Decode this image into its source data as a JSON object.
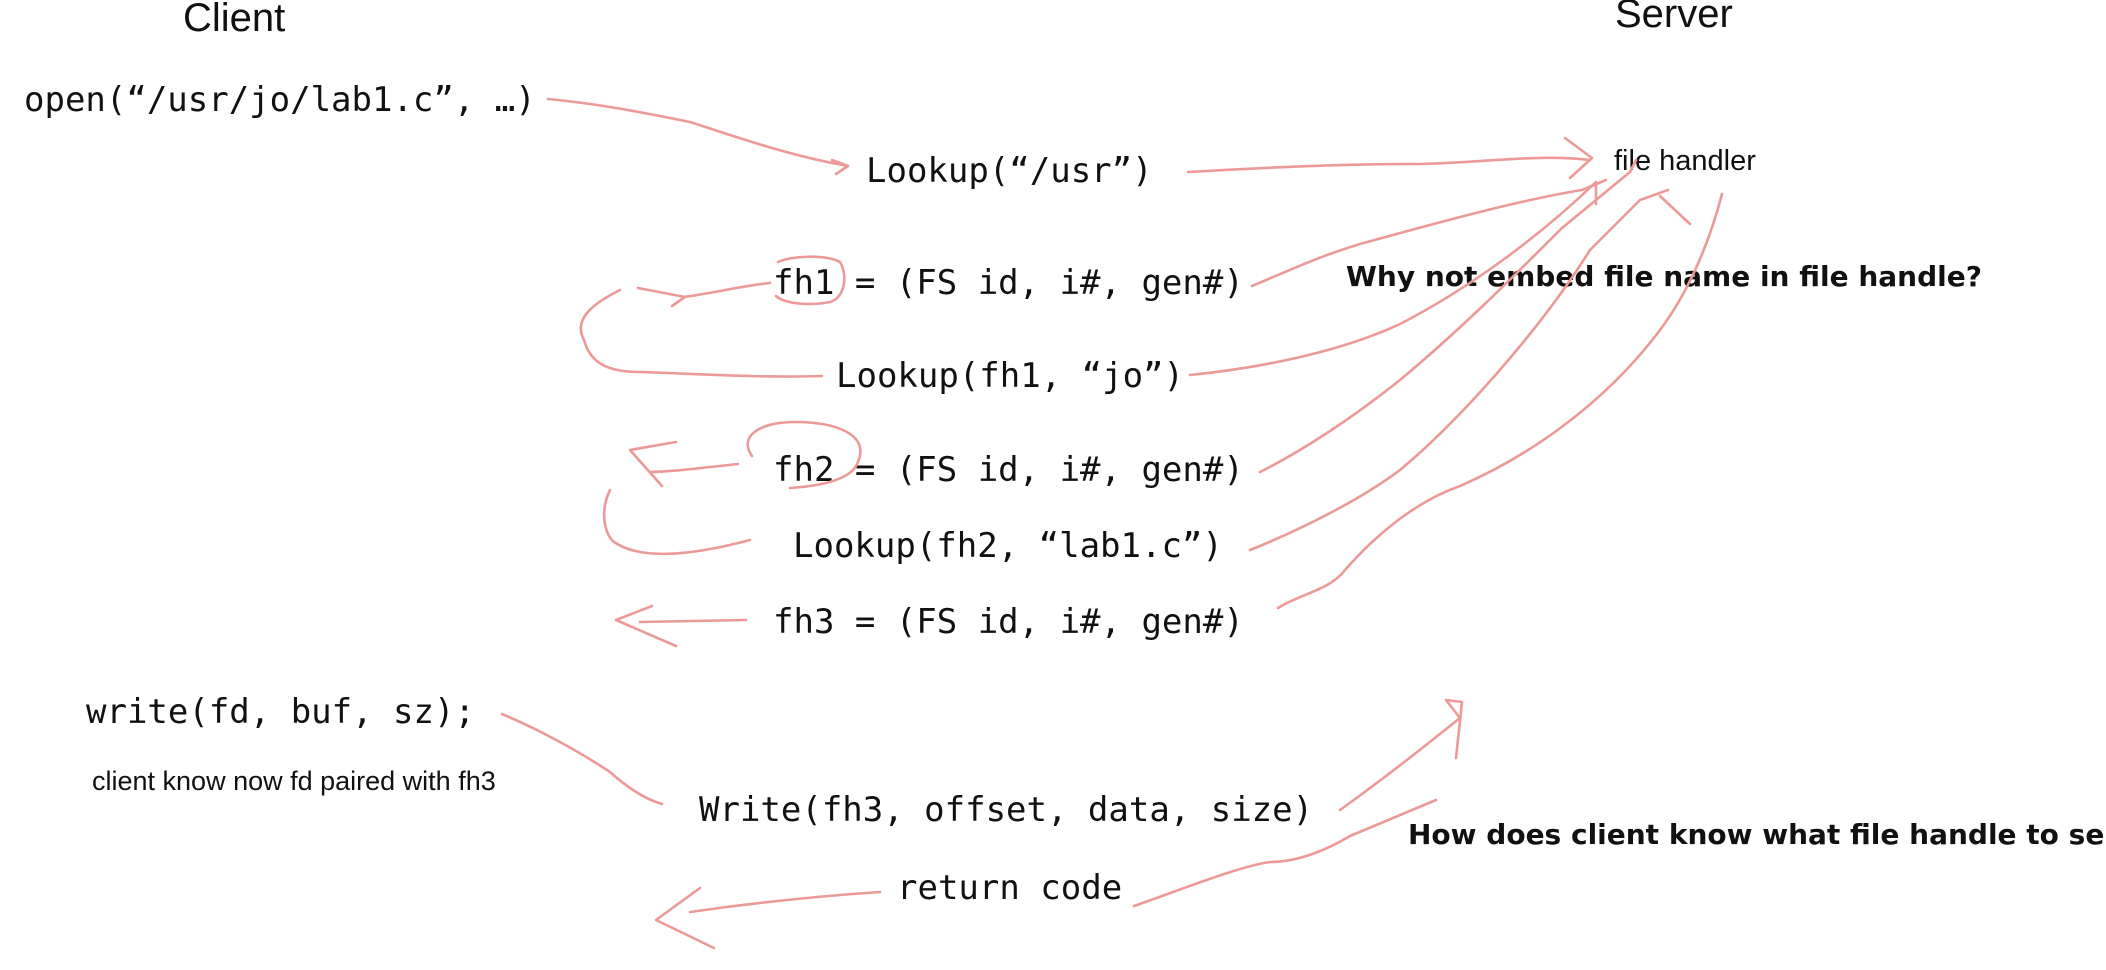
{
  "headers": {
    "client": "Client",
    "server": "Server"
  },
  "client_calls": {
    "open": "open(“/usr/jo/lab1.c”, …)",
    "write": "write(fd, buf, sz);",
    "note": "client know now fd paired with fh3"
  },
  "messages": {
    "lookup_usr": "Lookup(“/usr”)",
    "fh1": "fh1 = (FS id, i#, gen#)",
    "lookup_jo": "Lookup(fh1, “jo”)",
    "fh2": "fh2 = (FS id, i#, gen#)",
    "lookup_lab1": "Lookup(fh2, “lab1.c”)",
    "fh3": "fh3 = (FS id, i#, gen#)",
    "write_fh3": "Write(fh3, offset, data, size)",
    "return_code": "return code"
  },
  "server_side": {
    "file_handler": "file handler",
    "question_embed": "Why not embed file name in file handle?",
    "question_client": "How does client know what file handle to send?"
  },
  "colors": {
    "ink": "#ec9a98",
    "text": "#111111"
  }
}
